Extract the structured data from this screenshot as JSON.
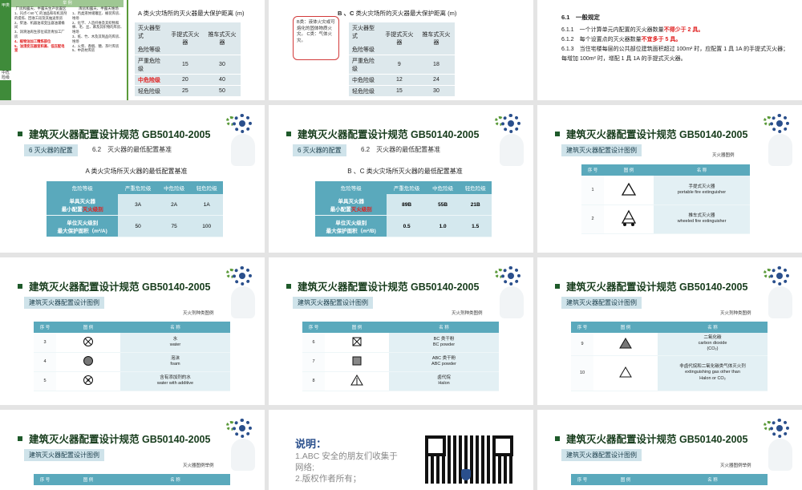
{
  "slide1": {
    "mini_head": "举 例",
    "left_col_label_top": "甲类",
    "left_col_label": "中危险级",
    "col1_title": "厂房和露天、半露天生产装置区",
    "col2_title": "库房和露天、半露天堆场",
    "col1_lines": [
      "1、闪点＜60 ℃ 的油品和有机溶剂的提炼、回收工段及其抽送泵房",
      "2、柴油、机器油或变压器油灌桶间",
      "3、润滑油再生部位或沥青加工厂房",
      "4、植物油加工精炼部位",
      "5、油浸变压器室和高、低压配电室"
    ],
    "col2_lines": [
      "1、丙类液体储罐区、桶装库房、堆场",
      "2、化学、人造纤维及其织物和棉、毛、丝、麻及其织物的库房、堆场",
      "3、纸、竹、木及其制品的库房、堆场",
      "4、火柴、香烟、糖、茶叶库房",
      "5、中药材库房"
    ],
    "col1_red": [
      "4、植物油加工精炼部位",
      "5、油浸变压器室和高、低压配电室"
    ],
    "caption": "A 类火灾场所的灭火器最大保护距离 (m)",
    "table_head": [
      "灭火器型式",
      "手提式灭火器",
      "推车式灭火器"
    ],
    "table_head_row": "危险等级",
    "rows": [
      {
        "level": "严重危险级",
        "a": "15",
        "b": "30"
      },
      {
        "level": "中危险级",
        "a": "20",
        "b": "40"
      },
      {
        "level": "轻危险级",
        "a": "25",
        "b": "50"
      }
    ]
  },
  "slide2": {
    "caption_prefix": "B 、C",
    "caption": "类火灾场所的灭火器最大保护距离 (m)",
    "note": "B类：液体火灾或可熔化的固体物质火灾。 C类：气体火灾。",
    "table_head": [
      "灭火器型式",
      "手提式灭火器",
      "推车式灭火器"
    ],
    "table_head_row": "危险等级",
    "rows": [
      {
        "level": "严重危险级",
        "a": "9",
        "b": "18"
      },
      {
        "level": "中危险级",
        "a": "12",
        "b": "24"
      },
      {
        "level": "轻危险级",
        "a": "15",
        "b": "30"
      }
    ]
  },
  "slide3": {
    "heading": "6.1　一般规定",
    "r1_pre": "6.1.1　一个计算单元内配置的灭火器数量",
    "r1_red": "不得少于 2 具。",
    "r2_pre": "6.1.2　每个设置点的灭火器数量",
    "r2_red": "不宜多于 5 具。",
    "r3": "6.1.3　当住宅楼每层的公共部位建筑面积超过 100m² 时，应配置 1 具 1A 的手提式灭火器；每增加 100m² 时，增配 1 具 1A 的手提式灭火器。"
  },
  "common": {
    "title": "建筑灭火器配置设计规范 GB50140-2005",
    "tag_config": "6  灭火器的配置",
    "sub_62": "6.2　灭火器的最低配置基准",
    "tag_legend": "建筑灭火器配置设计图例",
    "legend_head": [
      "序 号",
      "图 例",
      "名 称"
    ]
  },
  "slide4": {
    "caption": "A 类火灾场所灭火器的最低配置基准",
    "head": [
      "危险等级",
      "严重危险级",
      "中危险级",
      "轻危险级"
    ],
    "row1_label_a": "单具灭火器",
    "row1_label_b": "最小配置",
    "row1_label_red": "灭火级别",
    "row1": [
      "3A",
      "2A",
      "1A"
    ],
    "row2_label_a": "单位灭火级别",
    "row2_label_b": "最大保护面积（m²/A)",
    "row2": [
      "50",
      "75",
      "100"
    ]
  },
  "slide5": {
    "caption": "B 、C 类火灾场所灭火器的最低配置基准",
    "head": [
      "危险等级",
      "严重危险级",
      "中危险级",
      "轻危险级"
    ],
    "row1_label_a": "单具灭火器",
    "row1_label_b": "最小配置",
    "row1_label_red": "灭火级别",
    "row1": [
      "89B",
      "55B",
      "21B"
    ],
    "row2_label_a": "单位灭火级别",
    "row2_label_b": "最大保护面积（m²/B)",
    "row2": [
      "0.5",
      "1.0",
      "1.5"
    ]
  },
  "slide6": {
    "caption": "灭火器图例",
    "rows": [
      {
        "no": "1",
        "icon": "triangle-icon",
        "cn": "手提式灭火器",
        "en": "portable fire extinguisher"
      },
      {
        "no": "2",
        "icon": "wheeled-triangle-icon",
        "cn": "推车式灭火器",
        "en": "wheeled fire extinguisher"
      }
    ]
  },
  "slide7": {
    "caption": "灭火剂种类图例",
    "rows": [
      {
        "no": "3",
        "icon": "circle-cross-icon",
        "cn": "水",
        "en": "water"
      },
      {
        "no": "4",
        "icon": "filled-circle-icon",
        "cn": "泡沫",
        "en": "foam"
      },
      {
        "no": "5",
        "icon": "circle-cross-dot-icon",
        "cn": "含有添加剂的水",
        "en": "water with additive"
      }
    ]
  },
  "slide8": {
    "caption": "灭火剂种类图例",
    "rows": [
      {
        "no": "6",
        "icon": "square-cross-icon",
        "cn": "BC 类干粉",
        "en": "BC powder"
      },
      {
        "no": "7",
        "icon": "hatched-square-icon",
        "cn": "ABC 类干粉",
        "en": "ABC powder"
      },
      {
        "no": "8",
        "icon": "triangle-line-icon",
        "cn": "卤代烷",
        "en": "Halon"
      }
    ]
  },
  "slide9": {
    "caption": "灭火剂种类图例",
    "rows": [
      {
        "no": "9",
        "icon": "filled-triangle-icon",
        "cn": "二氧化碳",
        "en": "carbon dioxide",
        "en2": "(CO₂)"
      },
      {
        "no": "10",
        "icon": "triangle-icon",
        "cn": "非卤代烷和二氧化碳类气体灭火剂",
        "en": "extinguishing gas other than",
        "en2": "Halon or CO₂"
      }
    ]
  },
  "slide10": {
    "caption": "灭火器图例举例"
  },
  "slide11": {
    "heading": "说明：",
    "line1": "1.ABC 安全的朋友们收集于网络;",
    "line2": "2.版权作者所有；"
  },
  "slide12": {
    "caption": "灭火器图例举例"
  }
}
